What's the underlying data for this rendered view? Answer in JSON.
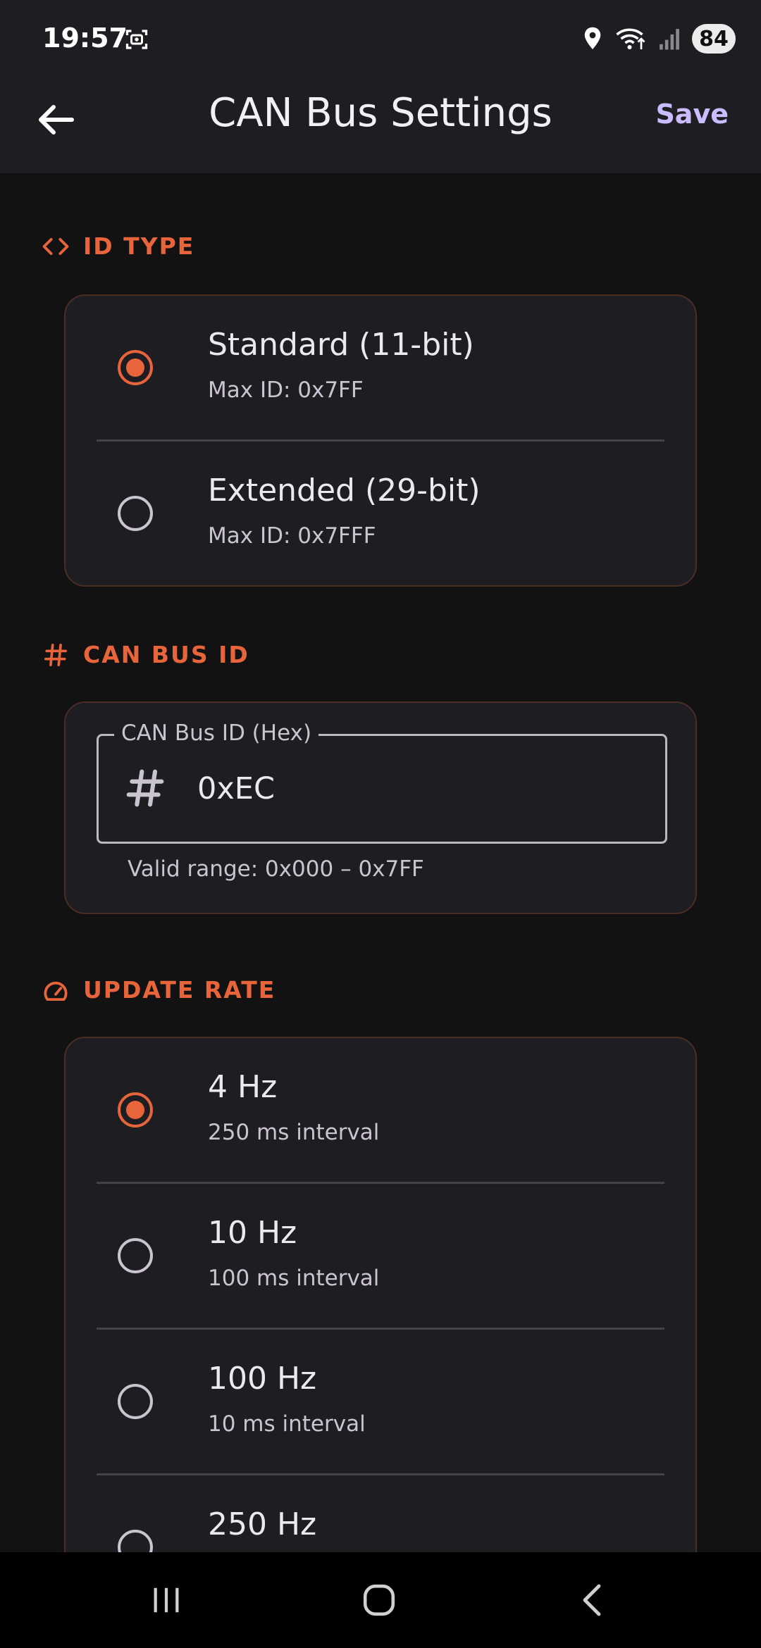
{
  "status_bar": {
    "time": "19:57",
    "battery": "84",
    "icons": [
      "screenshot-icon",
      "location-icon",
      "wifi-icon",
      "signal-icon"
    ]
  },
  "app_bar": {
    "title": "CAN Bus Settings",
    "save_label": "Save",
    "back_icon": "arrow-back-icon"
  },
  "colors": {
    "accent": "#e8643a",
    "save": "#cbbcff",
    "background": "#121212",
    "surface": "#1e1d22"
  },
  "id_type": {
    "header": "ID TYPE",
    "icon": "code-icon",
    "options": [
      {
        "title": "Standard (11-bit)",
        "subtitle": "Max ID: 0x7FF",
        "selected": true
      },
      {
        "title": "Extended (29-bit)",
        "subtitle": "Max ID: 0x7FFF",
        "selected": false
      }
    ]
  },
  "can_bus_id": {
    "header": "CAN BUS ID",
    "icon": "hash-icon",
    "field_label": "CAN Bus ID (Hex)",
    "value": "0xEC",
    "helper": "Valid range: 0x000 – 0x7FF"
  },
  "update_rate": {
    "header": "UPDATE RATE",
    "icon": "speedometer-icon",
    "options": [
      {
        "title": "4 Hz",
        "subtitle": "250 ms interval",
        "selected": true
      },
      {
        "title": "10 Hz",
        "subtitle": "100 ms interval",
        "selected": false
      },
      {
        "title": "100 Hz",
        "subtitle": "10 ms interval",
        "selected": false
      },
      {
        "title": "250 Hz",
        "subtitle": "",
        "selected": false
      }
    ]
  },
  "nav_bar": {
    "buttons": [
      "recent-apps-icon",
      "home-icon",
      "back-icon"
    ]
  }
}
